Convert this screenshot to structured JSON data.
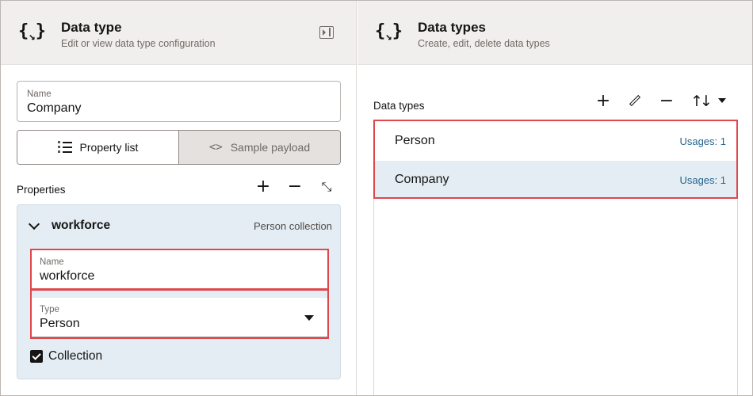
{
  "left_panel": {
    "icon": "braces-icon",
    "title": "Data type",
    "subtitle": "Edit or view data type configuration",
    "name_field": {
      "label": "Name",
      "value": "Company"
    },
    "tabs": [
      {
        "label": "Property list",
        "icon": "list-icon",
        "active": true
      },
      {
        "label": "Sample payload",
        "icon": "code-icon",
        "active": false
      }
    ],
    "properties_label": "Properties",
    "property": {
      "name": "workforce",
      "meta": "Person collection",
      "name_field": {
        "label": "Name",
        "value": "workforce"
      },
      "type_field": {
        "label": "Type",
        "value": "Person"
      },
      "collection_label": "Collection",
      "collection_checked": true
    }
  },
  "right_panel": {
    "icon": "braces-icon",
    "title": "Data types",
    "subtitle": "Create, edit, delete data types",
    "list_label": "Data types",
    "items": [
      {
        "name": "Person",
        "usages": "Usages: 1",
        "selected": false
      },
      {
        "name": "Company",
        "usages": "Usages: 1",
        "selected": true
      }
    ]
  },
  "colors": {
    "header_bg": "#f1efed",
    "selected_row_bg": "#e4edf4",
    "highlight": "#e0474c",
    "link": "#24658e"
  }
}
